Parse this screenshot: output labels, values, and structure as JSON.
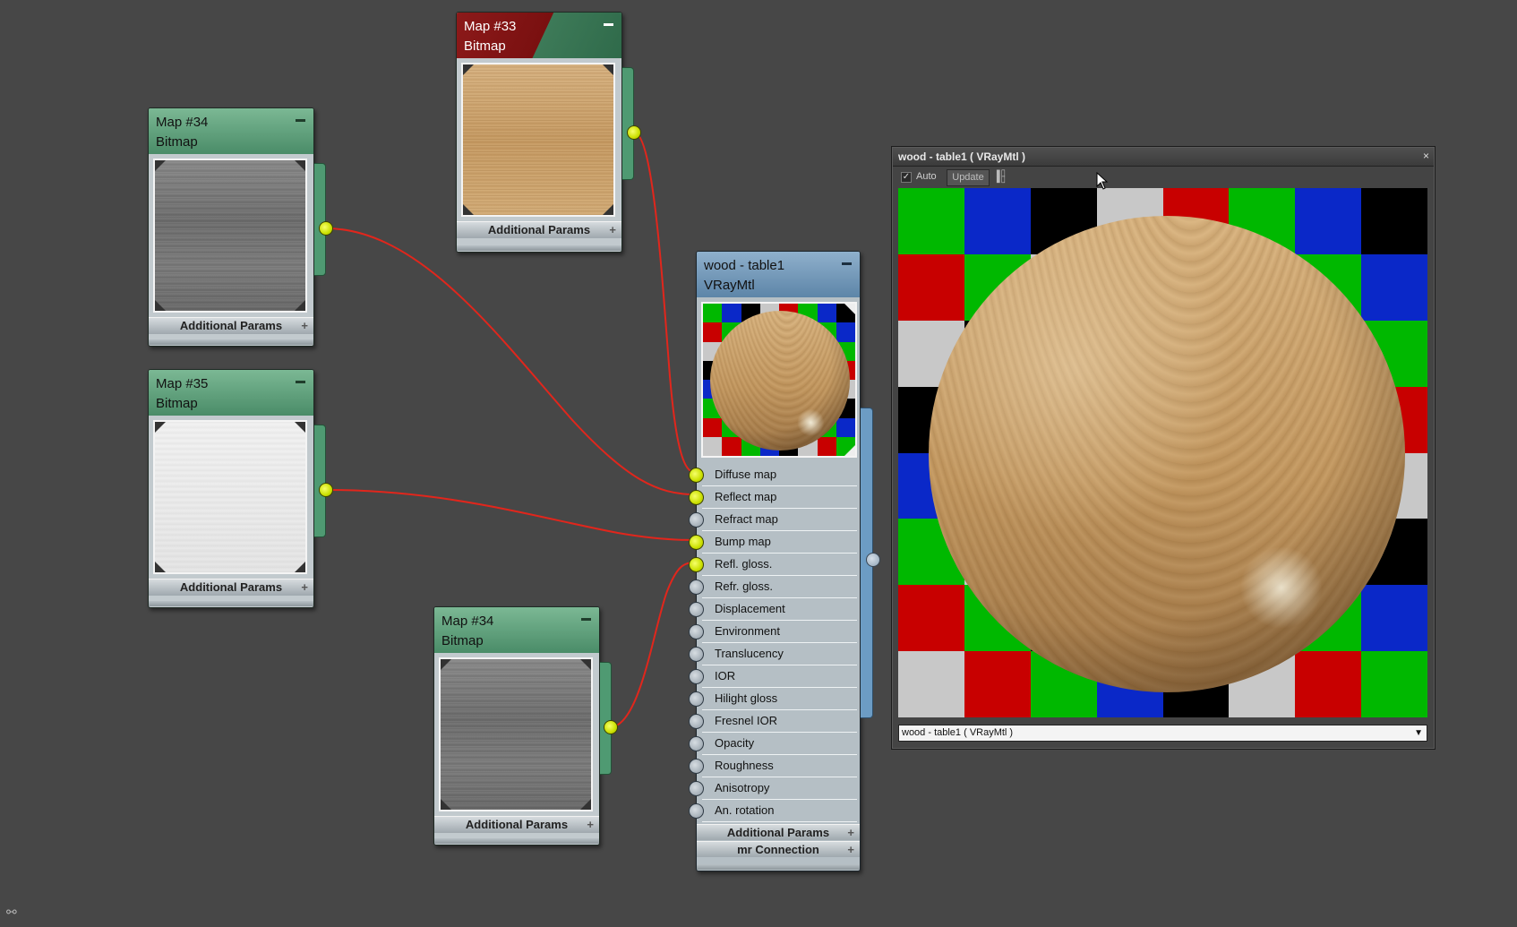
{
  "colors": {
    "canvas_bg": "#474747",
    "wire": "#e1261c",
    "socket_active": "#d7ec00",
    "bitmap_header": "#5fa27c",
    "vray_header": "#6f95b8",
    "checker_palette": [
      "#00b800",
      "#0a28c8",
      "#000000",
      "#c8c8c8",
      "#c80000"
    ]
  },
  "nodes": {
    "map34_top": {
      "title": "Map #34",
      "subtitle": "Bitmap",
      "additional_params": "Additional Params",
      "texture_icon": "gray-bitmap-icon"
    },
    "map35": {
      "title": "Map #35",
      "subtitle": "Bitmap",
      "additional_params": "Additional Params",
      "texture_icon": "white-bitmap-icon"
    },
    "map33": {
      "title": "Map #33",
      "subtitle": "Bitmap",
      "additional_params": "Additional Params",
      "texture_icon": "wood-bitmap-icon"
    },
    "map34_bottom": {
      "title": "Map #34",
      "subtitle": "Bitmap",
      "additional_params": "Additional Params",
      "texture_icon": "gray-bitmap-icon"
    }
  },
  "vray_node": {
    "title": "wood - table1",
    "subtitle": "VRayMtl",
    "slots": [
      {
        "label": "Diffuse map",
        "connected": true
      },
      {
        "label": "Reflect map",
        "connected": true
      },
      {
        "label": "Refract map",
        "connected": false
      },
      {
        "label": "Bump map",
        "connected": true
      },
      {
        "label": "Refl. gloss.",
        "connected": true
      },
      {
        "label": "Refr. gloss.",
        "connected": false
      },
      {
        "label": "Displacement",
        "connected": false
      },
      {
        "label": "Environment",
        "connected": false
      },
      {
        "label": "Translucency",
        "connected": false
      },
      {
        "label": "IOR",
        "connected": false
      },
      {
        "label": "Hilight gloss",
        "connected": false
      },
      {
        "label": "Fresnel IOR",
        "connected": false
      },
      {
        "label": "Opacity",
        "connected": false
      },
      {
        "label": "Roughness",
        "connected": false
      },
      {
        "label": "Anisotropy",
        "connected": false
      },
      {
        "label": "An. rotation",
        "connected": false
      }
    ],
    "additional_params": "Additional Params",
    "mr_connection": "mr Connection"
  },
  "connections": [
    {
      "from": "Map #34",
      "to": "Reflect map"
    },
    {
      "from": "Map #35",
      "to": "Bump map"
    },
    {
      "from": "Map #33",
      "to": "Diffuse map"
    },
    {
      "from": "Map #34",
      "to": "Refl. gloss."
    }
  ],
  "preview_window": {
    "title": "wood - table1  ( VRayMtl )",
    "close_label": "×",
    "auto_label": "Auto",
    "auto_checked": true,
    "update_label": "Update",
    "options_icon": "render-options-icon",
    "material_selector": "wood - table1  ( VRayMtl )",
    "checker": [
      [
        "G",
        "B",
        "K",
        "W",
        "R",
        "G",
        "B",
        "K"
      ],
      [
        "R",
        "G",
        "W",
        "K",
        "B",
        "R",
        "G",
        "B"
      ],
      [
        "W",
        "K",
        "G",
        "R",
        "W",
        "B",
        "R",
        "G"
      ],
      [
        "K",
        "B",
        "R",
        "G",
        "K",
        "G",
        "W",
        "R"
      ],
      [
        "B",
        "R",
        "W",
        "K",
        "G",
        "R",
        "B",
        "W"
      ],
      [
        "G",
        "W",
        "B",
        "R",
        "B",
        "K",
        "R",
        "K"
      ],
      [
        "R",
        "G",
        "K",
        "W",
        "R",
        "W",
        "G",
        "B"
      ],
      [
        "W",
        "R",
        "G",
        "B",
        "K",
        "W",
        "R",
        "G"
      ]
    ]
  },
  "status": {
    "binoculars_icon": "binoculars-icon"
  }
}
